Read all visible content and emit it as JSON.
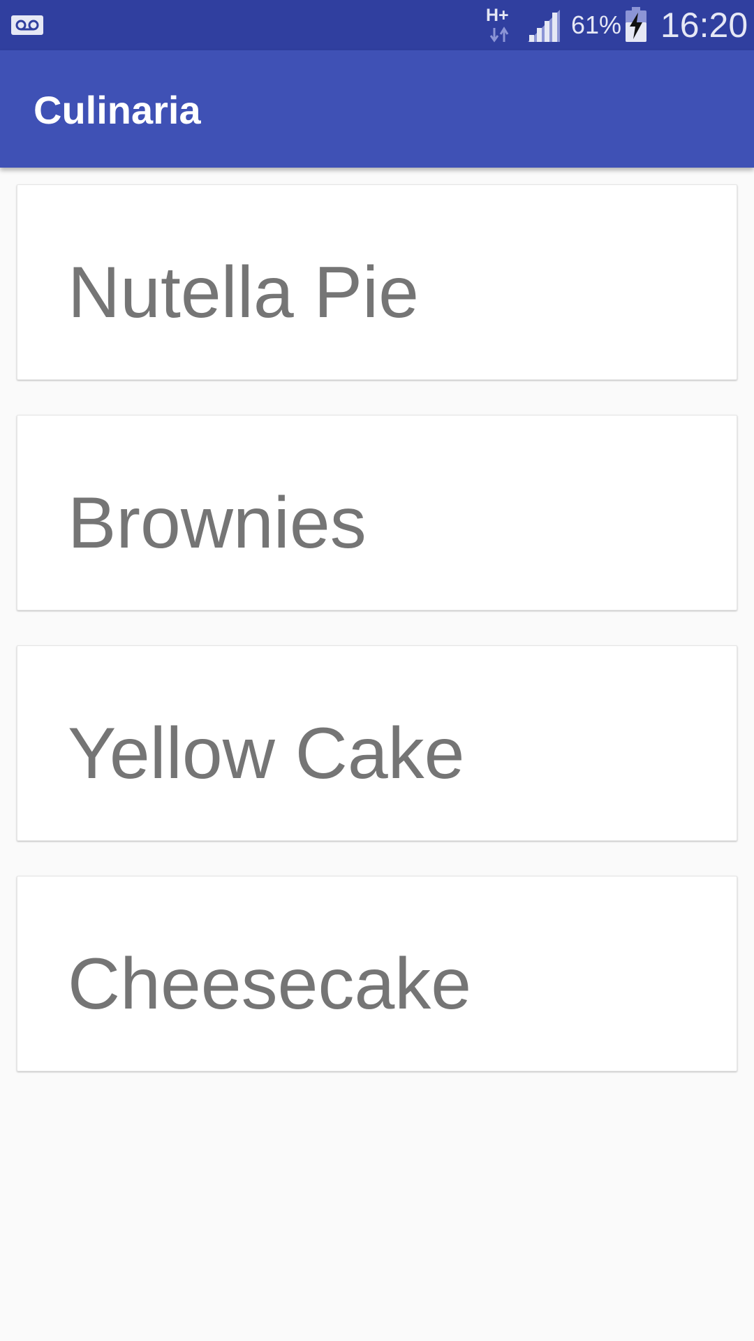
{
  "status_bar": {
    "network_label": "H+",
    "battery_percent": "61%",
    "time": "16:20",
    "icons": [
      "voicemail-icon",
      "network-arrows-icon",
      "signal-icon",
      "battery-charging-icon"
    ]
  },
  "app_bar": {
    "title": "Culinaria"
  },
  "recipes": [
    {
      "label": "Nutella Pie"
    },
    {
      "label": "Brownies"
    },
    {
      "label": "Yellow Cake"
    },
    {
      "label": "Cheesecake"
    }
  ],
  "colors": {
    "status_bar": "#303f9f",
    "app_bar": "#3f51b5",
    "background": "#fafafa",
    "card": "#ffffff",
    "card_text": "#757575"
  }
}
